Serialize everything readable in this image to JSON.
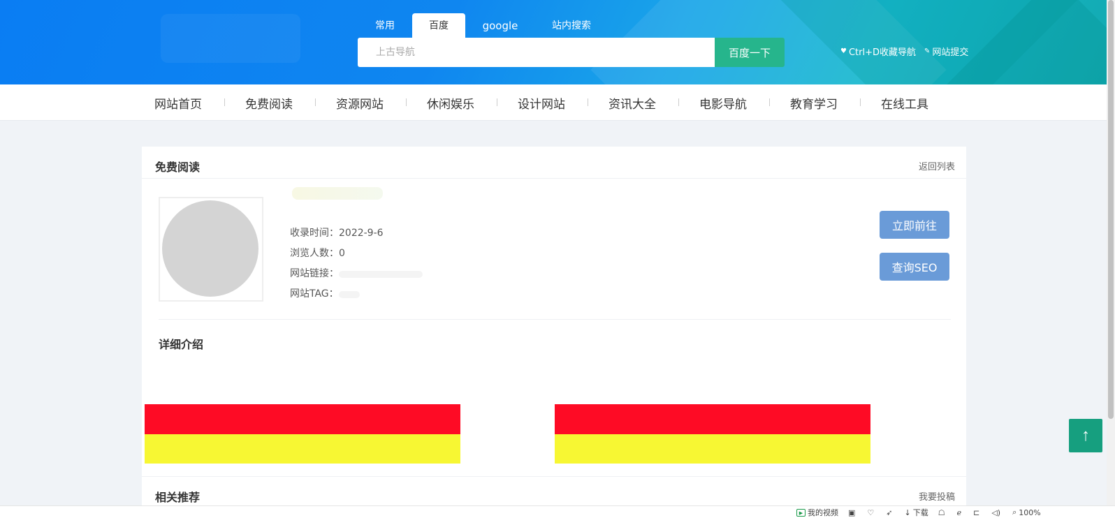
{
  "header": {
    "tabs": [
      "常用",
      "百度",
      "google",
      "站内搜索"
    ],
    "search_placeholder": "上古导航",
    "search_button": "百度一下",
    "links": [
      "Ctrl+D收藏导航",
      "网站提交"
    ]
  },
  "nav": {
    "items": [
      "网站首页",
      "免费阅读",
      "资源网站",
      "休闲娱乐",
      "设计网站",
      "资讯大全",
      "电影导航",
      "教育学习",
      "在线工具"
    ]
  },
  "card": {
    "title": "免费阅读",
    "back_link": "返回列表",
    "info": {
      "collect_time_label": "收录时间：",
      "collect_time_value": "2022-9-6",
      "views_label": "浏览人数：",
      "views_value": "0",
      "link_label": "网站链接：",
      "tag_label": "网站TAG："
    },
    "go_button": "立即前往",
    "seo_button": "查询SEO",
    "detail_title": "详细介绍"
  },
  "related": {
    "title": "相关推荐",
    "submit_link": "我要投稿"
  },
  "totop_icon": "arrow-up-icon",
  "statusbar": {
    "items": [
      "我的视频",
      "下载",
      "100%"
    ]
  },
  "colors": {
    "header_start": "#0a7df3",
    "header_end": "#12aab0",
    "search_button": "#26b58c",
    "action_button": "#6a9bd8",
    "totop": "#169f7f",
    "banner_red": "#fe0b25",
    "banner_yellow": "#f7f733"
  }
}
